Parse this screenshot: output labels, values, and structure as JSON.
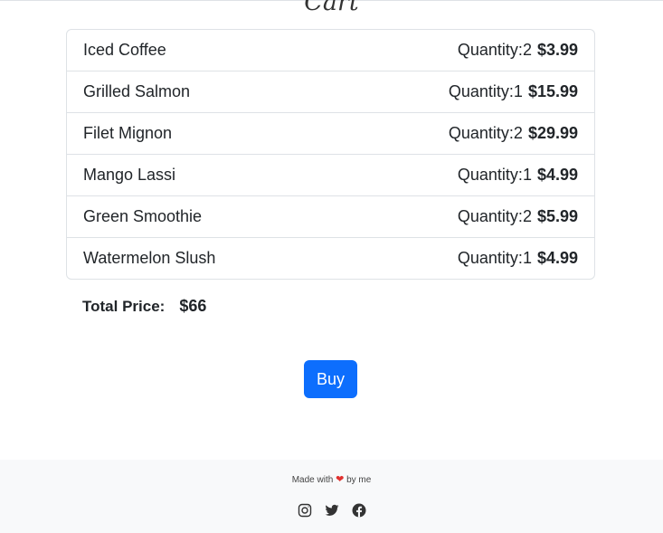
{
  "page": {
    "title": "Cart"
  },
  "cart": {
    "quantity_label": "Quantity:",
    "items": [
      {
        "name": "Iced Coffee",
        "quantity": "2",
        "price": "$3.99"
      },
      {
        "name": "Grilled Salmon",
        "quantity": "1",
        "price": "$15.99"
      },
      {
        "name": "Filet Mignon",
        "quantity": "2",
        "price": "$29.99"
      },
      {
        "name": "Mango Lassi",
        "quantity": "1",
        "price": "$4.99"
      },
      {
        "name": "Green Smoothie",
        "quantity": "2",
        "price": "$5.99"
      },
      {
        "name": "Watermelon Slush",
        "quantity": "1",
        "price": "$4.99"
      }
    ]
  },
  "total": {
    "label": "Total Price:",
    "value": "$66"
  },
  "actions": {
    "buy_label": "Buy"
  },
  "footer": {
    "made_with": "Made with",
    "by": "by me",
    "heart_symbol": "❤",
    "social": [
      {
        "icon": "instagram-icon"
      },
      {
        "icon": "twitter-icon"
      },
      {
        "icon": "facebook-icon"
      }
    ]
  },
  "colors": {
    "primary_button": "#0d6efd",
    "heart": "#e0312f",
    "footer_bg": "#f8f9fa"
  }
}
